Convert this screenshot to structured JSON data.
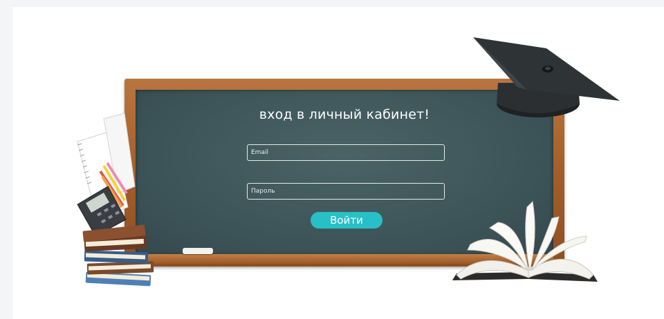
{
  "login": {
    "title": "вход в личный кабинет!",
    "email_placeholder": "Email",
    "password_placeholder": "Пароль",
    "submit_label": "Войти"
  },
  "colors": {
    "board": "#3d5559",
    "frame": "#a35f2a",
    "button": "#27c0c6"
  },
  "decorations": [
    "graduation-cap-icon",
    "open-book-icon",
    "book-stack-icon",
    "notebook-icon",
    "pencils-icon",
    "calculator-icon",
    "chalk-icon"
  ]
}
